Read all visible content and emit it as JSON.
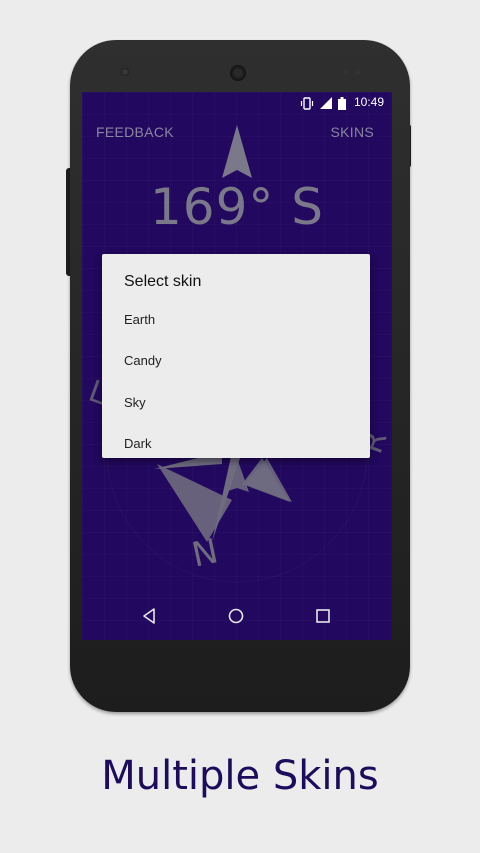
{
  "status_bar": {
    "time": "10:49",
    "icons": [
      "vibrate-icon",
      "signal-icon",
      "battery-icon"
    ]
  },
  "actions": {
    "feedback": "FEEDBACK",
    "skins": "SKINS"
  },
  "heading": {
    "text": "169° S"
  },
  "compass": {
    "cardinal_label": "N",
    "partial_left": "L",
    "partial_right": "R"
  },
  "dialog": {
    "title": "Select skin",
    "options": [
      "Earth",
      "Candy",
      "Sky",
      "Dark"
    ]
  },
  "nav": {
    "icons": [
      "back-icon",
      "home-icon",
      "recents-icon"
    ]
  },
  "caption": {
    "text": "Multiple Skins"
  },
  "colors": {
    "screen_background": "#22085e",
    "compass_gray": "#7b7889",
    "caption_color": "#1d0c5c",
    "dialog_background": "#ececec"
  }
}
